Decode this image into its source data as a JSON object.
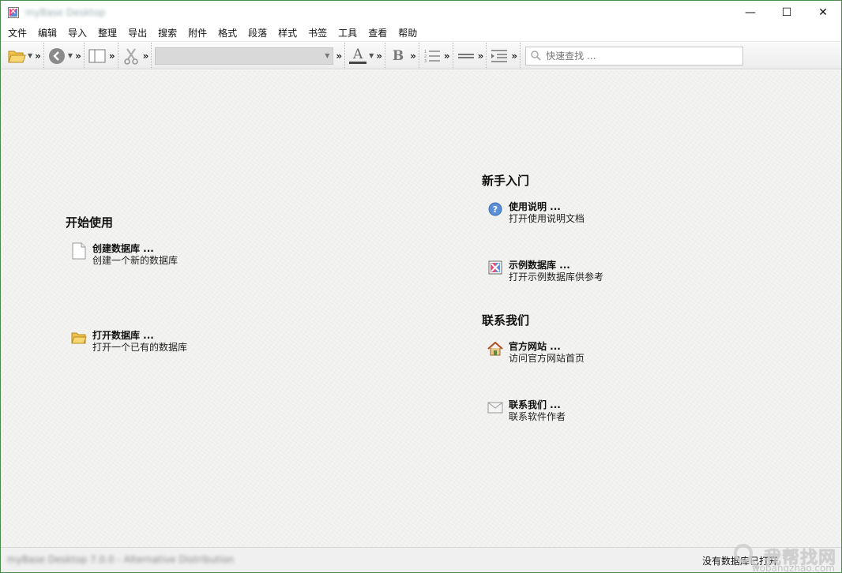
{
  "window": {
    "title": "myBase Desktop",
    "controls": {
      "minimize": "—",
      "maximize": "☐",
      "close": "✕"
    }
  },
  "menu": [
    "文件",
    "编辑",
    "导入",
    "整理",
    "导出",
    "搜索",
    "附件",
    "格式",
    "段落",
    "样式",
    "书签",
    "工具",
    "查看",
    "帮助"
  ],
  "toolbar": {
    "more": "»",
    "drop": "▼",
    "bold_label": "B",
    "font_color_label": "A",
    "search_placeholder": "快速查找 ..."
  },
  "start": {
    "heading": "开始使用",
    "create": {
      "title": "创建数据库 ...",
      "desc": "创建一个新的数据库",
      "icon": "new-document-icon"
    },
    "open": {
      "title": "打开数据库 ...",
      "desc": "打开一个已有的数据库",
      "icon": "open-folder-icon"
    }
  },
  "guide": {
    "heading": "新手入门",
    "manual": {
      "title": "使用说明 ...",
      "desc": "打开使用说明文档",
      "icon": "help-icon"
    },
    "sample": {
      "title": "示例数据库 ...",
      "desc": "打开示例数据库供参考",
      "icon": "sample-db-icon"
    }
  },
  "contact": {
    "heading": "联系我们",
    "website": {
      "title": "官方网站 ...",
      "desc": "访问官方网站首页",
      "icon": "home-icon"
    },
    "author": {
      "title": "联系我们 ...",
      "desc": "联系软件作者",
      "icon": "mail-icon"
    }
  },
  "status": {
    "left": "myBase Desktop 7.0.0 - Alternative Distribution",
    "right": "没有数据库已打开"
  },
  "watermark": {
    "text": "我帮找网",
    "url": "wobangzhao.com"
  },
  "colors": {
    "content_bg": "#f1f1ef",
    "window_border": "#4a8a4a",
    "accent_orange": "#f0a030"
  }
}
